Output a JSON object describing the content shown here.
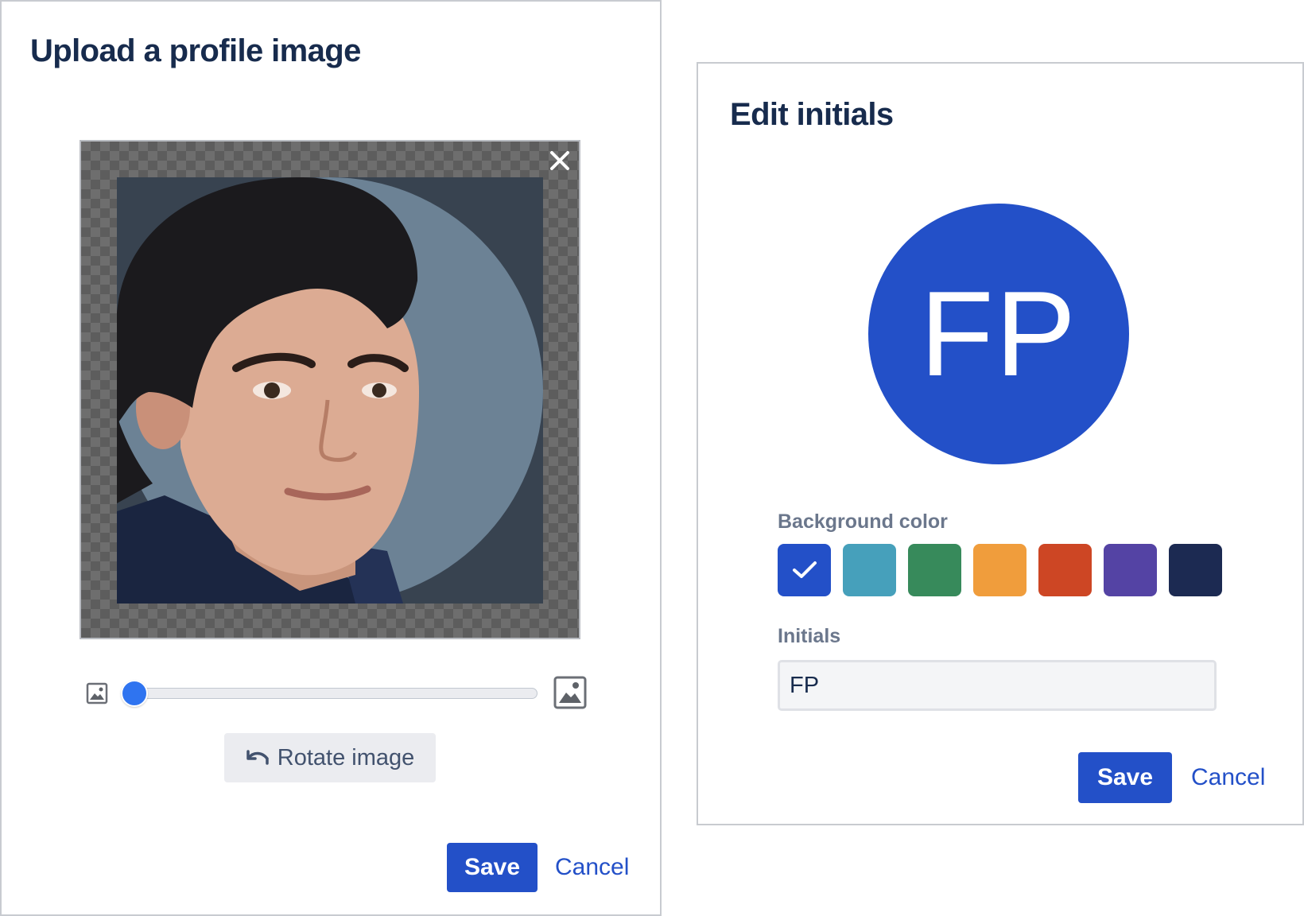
{
  "upload_dialog": {
    "title": "Upload a profile image",
    "rotate_label": "Rotate image",
    "save_label": "Save",
    "cancel_label": "Cancel",
    "zoom_level": 0,
    "icons": {
      "close": "close-icon",
      "zoom_out": "image-small-icon",
      "zoom_in": "image-large-icon",
      "rotate": "rotate-left-icon"
    }
  },
  "initials_dialog": {
    "title": "Edit initials",
    "avatar_text": "FP",
    "background_color_label": "Background color",
    "colors": [
      "#2350c8",
      "#46a0bb",
      "#378a5b",
      "#f09d3c",
      "#cd4624",
      "#5443a4",
      "#1c2a52"
    ],
    "selected_color_index": 0,
    "initials_label": "Initials",
    "initials_value": "FP",
    "save_label": "Save",
    "cancel_label": "Cancel"
  },
  "colors": {
    "primary": "#2350c8",
    "heading": "#172b4d",
    "muted": "#6b778c",
    "slider_thumb": "#2f74f0"
  }
}
